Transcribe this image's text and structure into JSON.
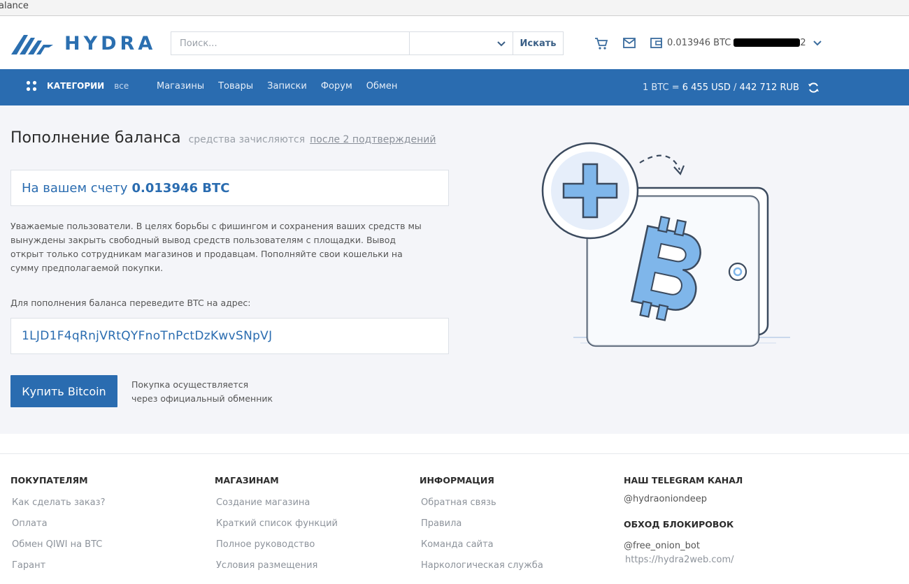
{
  "tab": {
    "title_fragment": "alance"
  },
  "header": {
    "logo_text": "HYDRA",
    "search_placeholder": "Поиск...",
    "search_button": "Искать",
    "wallet_balance": "0.013946 BTC",
    "wallet_tail": "2"
  },
  "nav": {
    "categories_label": "КАТЕГОРИИ",
    "categories_all": "все",
    "links": [
      "Магазины",
      "Товары",
      "Записки",
      "Форум",
      "Обмен"
    ],
    "rate_prefix": "1 BTC = ",
    "rate_usd": "6 455 USD",
    "rate_sep": " / ",
    "rate_rub": "442 712 RUB"
  },
  "main": {
    "title": "Пополнение баланса",
    "title_sub": "средства зачисляются",
    "title_link": "после 2 подтверждений",
    "balance_prefix": "На вашем счету",
    "balance_value": "0.013946 BTC",
    "notice": "Уважаемые пользователи. В целях борьбы с фишингом и сохранения ваших средств мы вынуждены закрыть свободный вывод средств пользователям с площадки. Вывод открыт только сотрудникам магазинов и продавцам. Пополняйте свои кошельки на сумму предполагаемой покупки.",
    "address_label": "Для пополнения баланса переведите BTC на адрес:",
    "address": "1LJD1F4qRnjVRtQYFnoTnPctDzKwvSNpVJ",
    "buy_button": "Купить Bitcoin",
    "buy_note_line1": "Покупка осуществляется",
    "buy_note_line2": "через официальный обменник"
  },
  "footer": {
    "buyers": {
      "heading": "ПОКУПАТЕЛЯМ",
      "links": [
        "Как сделать заказ?",
        "Оплата",
        "Обмен QIWI на BTC",
        "Гарант"
      ]
    },
    "shops": {
      "heading": "МАГАЗИНАМ",
      "links": [
        "Создание магазина",
        "Краткий список функций",
        "Полное руководство",
        "Условия размещения"
      ]
    },
    "info": {
      "heading": "ИНФОРМАЦИЯ",
      "links": [
        "Обратная связь",
        "Правила",
        "Команда сайта",
        "Наркологическая служба"
      ]
    },
    "telegram": {
      "heading": "НАШ TELEGRAM КАНАЛ",
      "handle": "@hydraoniondeep",
      "bypass_heading": "ОБХОД БЛОКИРОВОК",
      "bot": "@free_onion_bot",
      "url": "https://hydra2web.com/"
    }
  },
  "colors": {
    "brand": "#2a6cb0",
    "page_bg": "#f4f5f9",
    "icon_light_blue": "#7fb6ea"
  },
  "icons": [
    "logo-icon",
    "chevron-down-icon",
    "cart-icon",
    "mail-icon",
    "wallet-icon",
    "grid-icon",
    "refresh-icon",
    "wallet-plus-bitcoin-illustration"
  ]
}
